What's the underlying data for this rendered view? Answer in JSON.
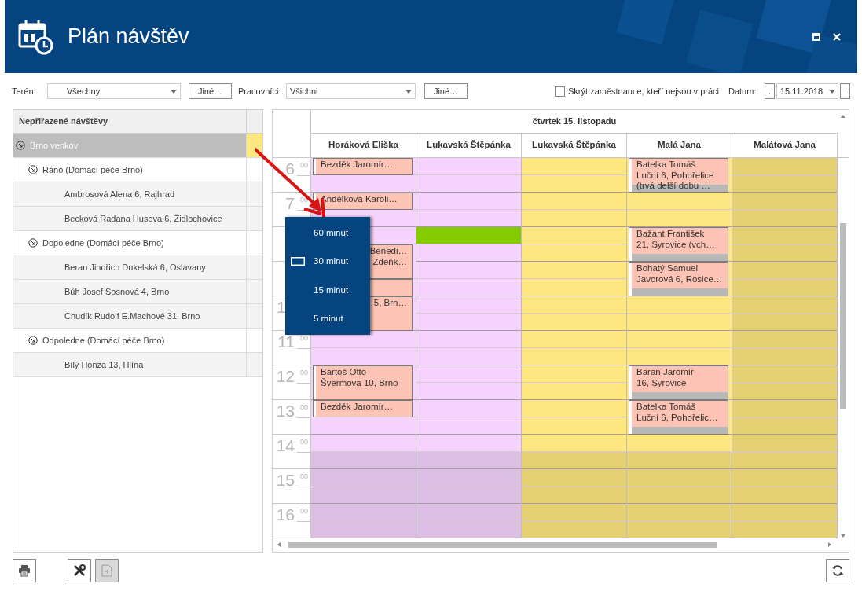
{
  "window": {
    "title": "Plán návštěv"
  },
  "toolbar": {
    "teren_label": "Terén:",
    "teren_value": "Všechny",
    "teren_button": "Jiné…",
    "workers_label": "Pracovníci:",
    "workers_value": "Všichni",
    "workers_button": "Jiné…",
    "hide_absent": {
      "label": "Skrýt zaměstnance, kteří nejsou v práci",
      "checked": false
    },
    "date_label": "Datum:",
    "prev_button": ".",
    "date_value": "15.11.2018",
    "next_button": "."
  },
  "tree": {
    "header": "Nepřiřazené návštěvy",
    "items": [
      {
        "label": "Brno venkov",
        "selected": true,
        "expanded": true,
        "children": [
          {
            "label": "Ráno (Domácí péče Brno)",
            "selected": false,
            "expanded": true,
            "children": [
              {
                "label": "Ambrosová Alena 6, Rajhrad",
                "selected": false
              },
              {
                "label": "Becková Radana Husova 6, Židlochovice",
                "selected": false
              }
            ]
          },
          {
            "label": "Dopoledne (Domácí péče Brno)",
            "selected": false,
            "expanded": true,
            "children": [
              {
                "label": "Beran Jindřich Dukelská 6, Oslavany",
                "selected": false
              },
              {
                "label": "Bůh Josef Sosnová 4, Brno",
                "selected": false
              },
              {
                "label": "Chudík Rudolf E.Machové 31, Brno",
                "selected": false
              }
            ]
          },
          {
            "label": "Odpoledne (Domácí péče Brno)",
            "selected": false,
            "expanded": true,
            "children": [
              {
                "label": "Bílý Honza 13, Hlína",
                "selected": false
              }
            ]
          }
        ]
      }
    ]
  },
  "schedule": {
    "day": "čtvrtek 15. listopadu",
    "hours": [
      {
        "kind": "full",
        "hour": "6",
        "minutes": "00"
      },
      {
        "kind": "full",
        "hour": "7",
        "minutes": "00"
      },
      {
        "kind": "covered"
      },
      {
        "kind": "covered"
      },
      {
        "kind": "partial",
        "hour": "1"
      },
      {
        "kind": "full",
        "hour": "11",
        "minutes": "00"
      },
      {
        "kind": "full",
        "hour": "12",
        "minutes": "00"
      },
      {
        "kind": "full",
        "hour": "13",
        "minutes": "00"
      },
      {
        "kind": "full",
        "hour": "14",
        "minutes": "00"
      },
      {
        "kind": "full",
        "hour": "15",
        "minutes": "00"
      },
      {
        "kind": "full",
        "hour": "16",
        "minutes": "00"
      }
    ],
    "columns": [
      {
        "name": "Horáková Eliška",
        "color": "#f5d3fd",
        "slots": [
          {
            "kind": "event",
            "lines": [
              "Bezděk Jaromír…"
            ],
            "bar": false
          },
          {
            "kind": "free"
          },
          {
            "kind": "event",
            "lines": [
              "Andělková Karoli…"
            ],
            "bar": false
          },
          {
            "kind": "free"
          },
          {
            "kind": "free"
          },
          {
            "kind": "partial_event",
            "lines": [
              "Benedi…",
              "Zdeňk…"
            ],
            "bar": false
          },
          {
            "kind": "continued"
          },
          {
            "kind": "event",
            "bar": false
          },
          {
            "kind": "partial_event",
            "lines": [
              "5, Brn…"
            ],
            "bar": false
          },
          {
            "kind": "continued"
          },
          {
            "kind": "free"
          },
          {
            "kind": "free"
          },
          {
            "kind": "event",
            "lines": [
              "Bartoš Otto",
              "Švermova 10, Brno"
            ],
            "bar": false
          },
          {
            "kind": "continued"
          },
          {
            "kind": "event",
            "lines": [
              "Bezděk Jaromír…"
            ],
            "bar": false
          },
          {
            "kind": "free"
          },
          {
            "kind": "free"
          },
          {
            "kind": "off"
          },
          {
            "kind": "off"
          },
          {
            "kind": "off"
          },
          {
            "kind": "off"
          },
          {
            "kind": "off"
          }
        ]
      },
      {
        "name": "Lukavská Štěpánka",
        "color": "#f5d3fd",
        "slots": [
          {
            "kind": "free"
          },
          {
            "kind": "free"
          },
          {
            "kind": "free"
          },
          {
            "kind": "free"
          },
          {
            "kind": "marked"
          },
          {
            "kind": "free"
          },
          {
            "kind": "free"
          },
          {
            "kind": "free"
          },
          {
            "kind": "free"
          },
          {
            "kind": "free"
          },
          {
            "kind": "free"
          },
          {
            "kind": "free"
          },
          {
            "kind": "free"
          },
          {
            "kind": "free"
          },
          {
            "kind": "free"
          },
          {
            "kind": "free"
          },
          {
            "kind": "free"
          },
          {
            "kind": "off"
          },
          {
            "kind": "off"
          },
          {
            "kind": "off"
          },
          {
            "kind": "off"
          },
          {
            "kind": "off"
          }
        ]
      },
      {
        "name": "Lukavská Štěpánka",
        "color": "#fee780",
        "slots": [
          {
            "kind": "free"
          },
          {
            "kind": "free"
          },
          {
            "kind": "free"
          },
          {
            "kind": "free"
          },
          {
            "kind": "free"
          },
          {
            "kind": "free"
          },
          {
            "kind": "free"
          },
          {
            "kind": "free"
          },
          {
            "kind": "free"
          },
          {
            "kind": "free"
          },
          {
            "kind": "free"
          },
          {
            "kind": "free"
          },
          {
            "kind": "free"
          },
          {
            "kind": "free"
          },
          {
            "kind": "free"
          },
          {
            "kind": "free"
          },
          {
            "kind": "free"
          },
          {
            "kind": "off"
          },
          {
            "kind": "off"
          },
          {
            "kind": "off"
          },
          {
            "kind": "off"
          },
          {
            "kind": "off"
          }
        ]
      },
      {
        "name": "Malá Jana",
        "color": "#fee780",
        "slots": [
          {
            "kind": "event",
            "lines": [
              "Batelka Tomáš",
              "Luční 6, Pohořelice",
              "(trvá delší dobu …"
            ],
            "bar": true
          },
          {
            "kind": "continued"
          },
          {
            "kind": "free"
          },
          {
            "kind": "free"
          },
          {
            "kind": "event",
            "lines": [
              "Bažant František",
              "21, Syrovice (vch…"
            ],
            "bar": true
          },
          {
            "kind": "continued"
          },
          {
            "kind": "event",
            "lines": [
              "Bohatý Samuel",
              "Javorová 6, Rosice…"
            ],
            "bar": true
          },
          {
            "kind": "continued"
          },
          {
            "kind": "free"
          },
          {
            "kind": "free"
          },
          {
            "kind": "free"
          },
          {
            "kind": "free"
          },
          {
            "kind": "event",
            "lines": [
              "Baran Jaromír",
              "16, Syrovice"
            ],
            "bar": true
          },
          {
            "kind": "continued"
          },
          {
            "kind": "event",
            "lines": [
              "Batelka Tomáš",
              "Luční 6, Pohořelic…"
            ],
            "bar": true
          },
          {
            "kind": "continued"
          },
          {
            "kind": "free"
          },
          {
            "kind": "off"
          },
          {
            "kind": "off"
          },
          {
            "kind": "off"
          },
          {
            "kind": "off"
          },
          {
            "kind": "off"
          }
        ]
      },
      {
        "name": "Malátová Jana",
        "color": "#e5d073",
        "slots": [
          {
            "kind": "free"
          },
          {
            "kind": "free"
          },
          {
            "kind": "free"
          },
          {
            "kind": "free"
          },
          {
            "kind": "free"
          },
          {
            "kind": "free"
          },
          {
            "kind": "free"
          },
          {
            "kind": "free"
          },
          {
            "kind": "free"
          },
          {
            "kind": "free"
          },
          {
            "kind": "free"
          },
          {
            "kind": "free"
          },
          {
            "kind": "free"
          },
          {
            "kind": "free"
          },
          {
            "kind": "free"
          },
          {
            "kind": "free"
          },
          {
            "kind": "free"
          },
          {
            "kind": "free"
          },
          {
            "kind": "free"
          },
          {
            "kind": "free"
          },
          {
            "kind": "free"
          },
          {
            "kind": "free"
          }
        ]
      }
    ]
  },
  "interval_menu": [
    {
      "label": "60 minut",
      "selected": false
    },
    {
      "label": "30 minut",
      "selected": true
    },
    {
      "label": "15 minut",
      "selected": false
    },
    {
      "label": "5 minut",
      "selected": false
    }
  ],
  "bottom_toolbar": [
    {
      "kind": "print",
      "disabled": false
    },
    {
      "kind": "tools",
      "disabled": false
    },
    {
      "kind": "export",
      "disabled": true
    },
    {
      "kind": "refresh",
      "disabled": false
    }
  ]
}
